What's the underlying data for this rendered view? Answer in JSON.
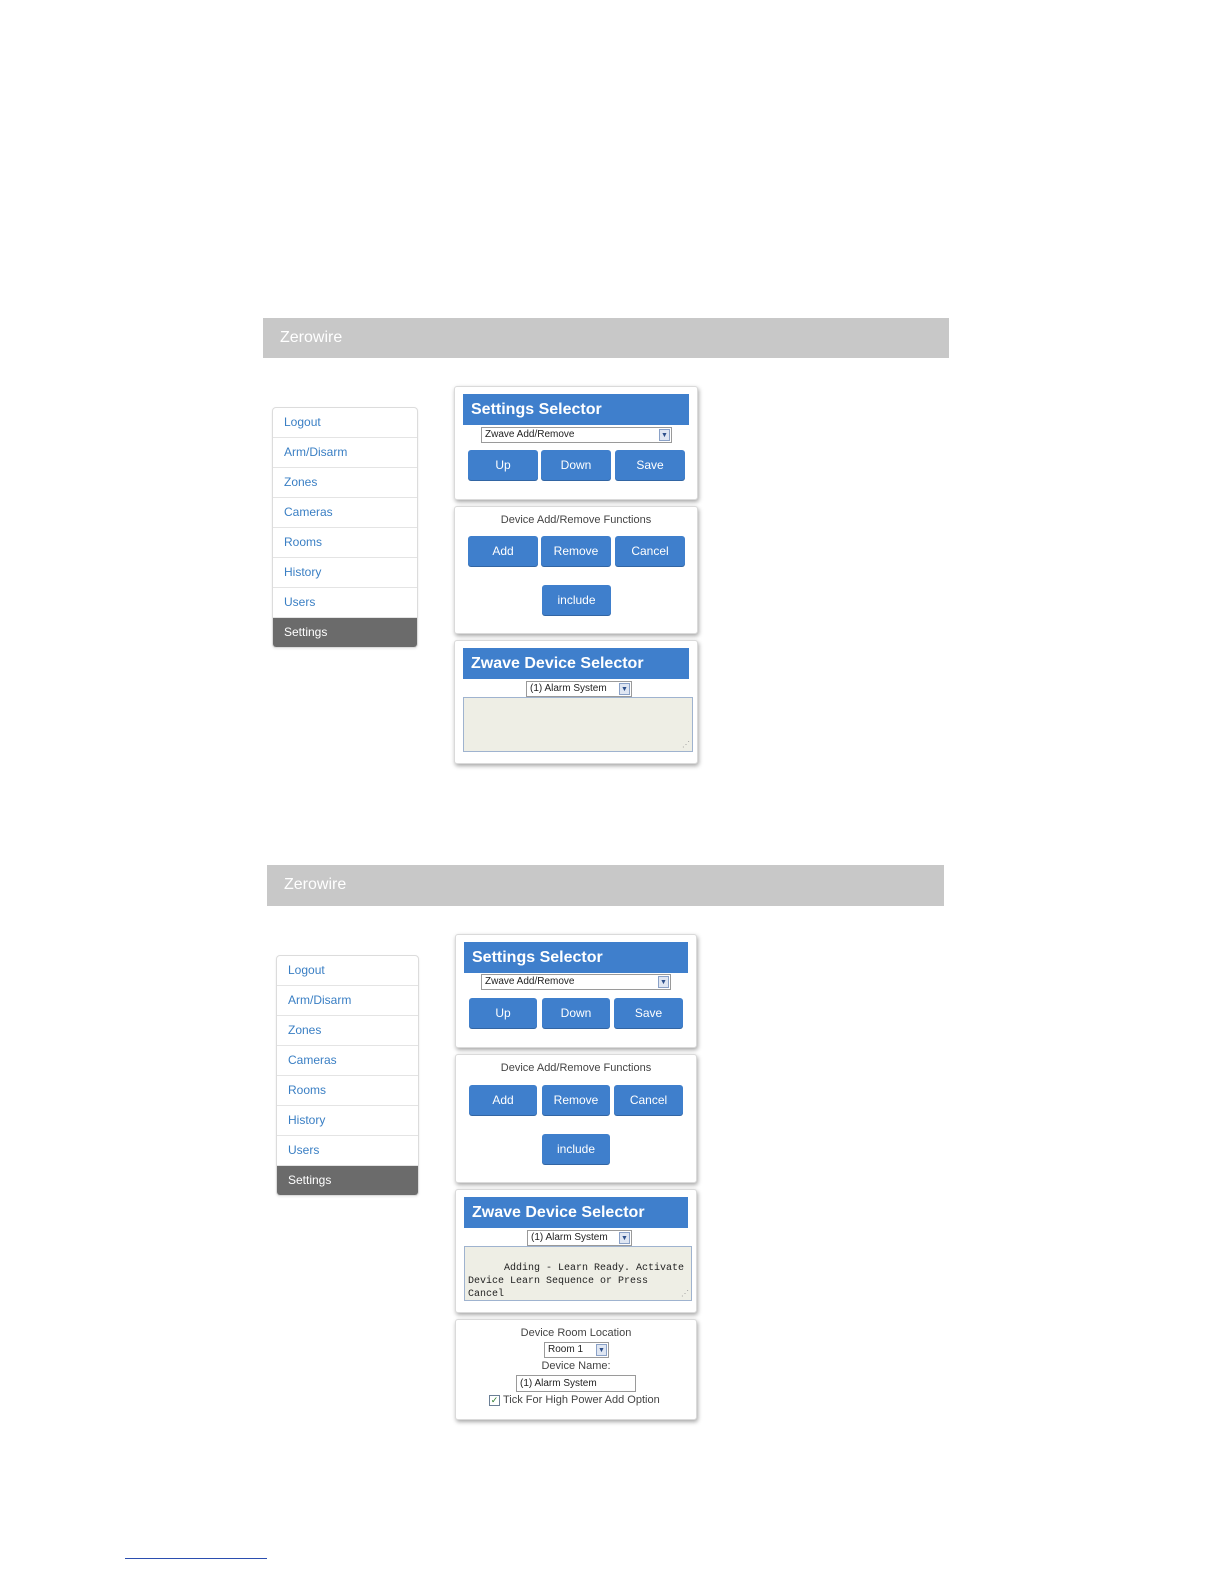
{
  "shots": [
    {
      "brand": "Zerowire",
      "nav": [
        "Logout",
        "Arm/Disarm",
        "Zones",
        "Cameras",
        "Rooms",
        "History",
        "Users",
        "Settings"
      ],
      "active_nav": "Settings",
      "settings_selector": {
        "title": "Settings Selector",
        "selected": "Zwave Add/Remove",
        "buttons": [
          "Up",
          "Down",
          "Save"
        ]
      },
      "functions": {
        "title": "Device Add/Remove Functions",
        "buttons": [
          "Add",
          "Remove",
          "Cancel"
        ],
        "include": "include"
      },
      "device_selector": {
        "title": "Zwave Device Selector",
        "selected": "(1) Alarm System",
        "log": ""
      }
    },
    {
      "brand": "Zerowire",
      "nav": [
        "Logout",
        "Arm/Disarm",
        "Zones",
        "Cameras",
        "Rooms",
        "History",
        "Users",
        "Settings"
      ],
      "active_nav": "Settings",
      "settings_selector": {
        "title": "Settings Selector",
        "selected": "Zwave Add/Remove",
        "buttons": [
          "Up",
          "Down",
          "Save"
        ]
      },
      "functions": {
        "title": "Device Add/Remove Functions",
        "buttons": [
          "Add",
          "Remove",
          "Cancel"
        ],
        "include": "include"
      },
      "device_selector": {
        "title": "Zwave Device Selector",
        "selected": "(1) Alarm System",
        "log": "Adding - Learn Ready. Activate\nDevice Learn Sequence or Press\nCancel"
      },
      "device_details": {
        "room_label": "Device Room Location",
        "room_selected": "Room 1",
        "name_label": "Device Name:",
        "name_value": "(1) Alarm System",
        "high_power_label": "Tick For High Power Add Option",
        "high_power_checked": true
      }
    }
  ],
  "colors": {
    "header_blue": "#3f7fcc",
    "topbar_gray": "#c8c8c8",
    "active_nav": "#6b6b6b",
    "link": "#3a7fc4"
  }
}
